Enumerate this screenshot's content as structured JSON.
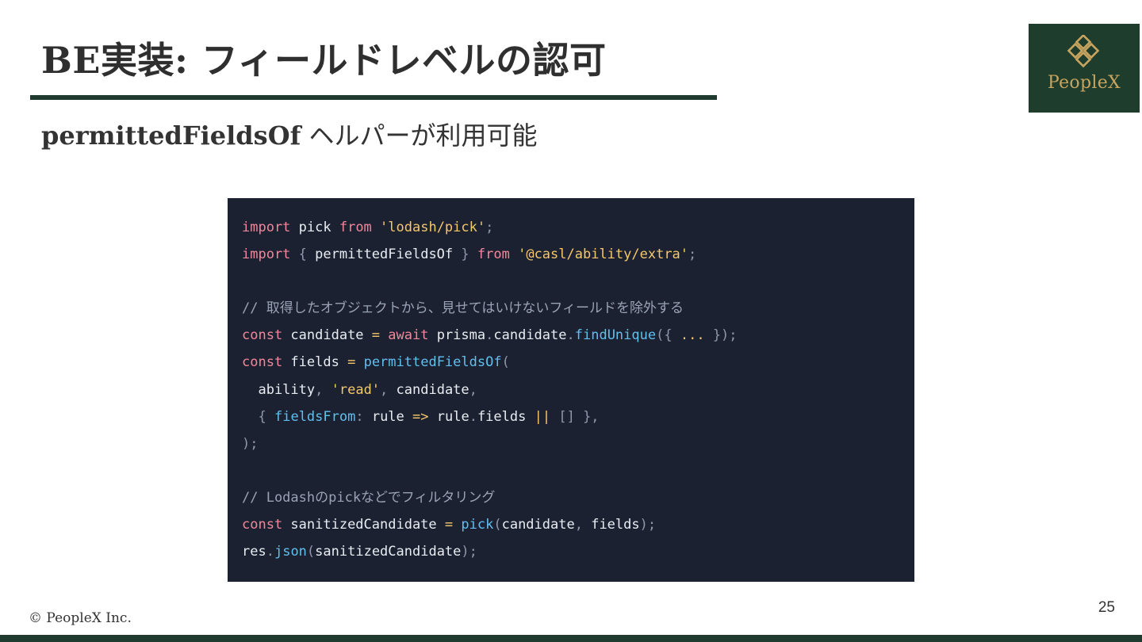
{
  "slide": {
    "title": "BE実装: フィールドレベルの認可",
    "subtitle_bold": "permittedFieldsOf",
    "subtitle_rest": " ヘルパーが利用可能",
    "logo_text": "PeopleX",
    "footer": "© PeopleX Inc.",
    "page_number": "25"
  },
  "colors": {
    "brand_dark_green": "#1f3b30",
    "logo_gold": "#c7a45f",
    "code_bg": "#1b2130"
  },
  "code_lines": [
    [
      {
        "t": "import",
        "c": "kw"
      },
      {
        "t": " pick ",
        "c": "tx"
      },
      {
        "t": "from",
        "c": "kw"
      },
      {
        "t": " ",
        "c": "tx"
      },
      {
        "t": "'lodash/pick'",
        "c": "str"
      },
      {
        "t": ";",
        "c": "pu"
      }
    ],
    [
      {
        "t": "import",
        "c": "kw"
      },
      {
        "t": " ",
        "c": "tx"
      },
      {
        "t": "{",
        "c": "pu"
      },
      {
        "t": " permittedFieldsOf ",
        "c": "tx"
      },
      {
        "t": "}",
        "c": "pu"
      },
      {
        "t": " ",
        "c": "tx"
      },
      {
        "t": "from",
        "c": "kw"
      },
      {
        "t": " ",
        "c": "tx"
      },
      {
        "t": "'@casl/ability/extra'",
        "c": "str"
      },
      {
        "t": ";",
        "c": "pu"
      }
    ],
    [],
    [
      {
        "t": "// 取得したオブジェクトから、見せてはいけないフィールドを除外する",
        "c": "cm"
      }
    ],
    [
      {
        "t": "const",
        "c": "kw"
      },
      {
        "t": " candidate ",
        "c": "tx"
      },
      {
        "t": "=",
        "c": "op"
      },
      {
        "t": " ",
        "c": "tx"
      },
      {
        "t": "await",
        "c": "kw"
      },
      {
        "t": " prisma",
        "c": "tx"
      },
      {
        "t": ".",
        "c": "pu"
      },
      {
        "t": "candidate",
        "c": "tx"
      },
      {
        "t": ".",
        "c": "pu"
      },
      {
        "t": "findUnique",
        "c": "fn"
      },
      {
        "t": "({",
        "c": "pu"
      },
      {
        "t": " ",
        "c": "tx"
      },
      {
        "t": "...",
        "c": "op"
      },
      {
        "t": " ",
        "c": "tx"
      },
      {
        "t": "});",
        "c": "pu"
      }
    ],
    [
      {
        "t": "const",
        "c": "kw"
      },
      {
        "t": " fields ",
        "c": "tx"
      },
      {
        "t": "=",
        "c": "op"
      },
      {
        "t": " ",
        "c": "tx"
      },
      {
        "t": "permittedFieldsOf",
        "c": "fn"
      },
      {
        "t": "(",
        "c": "pu"
      }
    ],
    [
      {
        "t": "  ability",
        "c": "tx"
      },
      {
        "t": ",",
        "c": "pu"
      },
      {
        "t": " ",
        "c": "tx"
      },
      {
        "t": "'read'",
        "c": "str"
      },
      {
        "t": ",",
        "c": "pu"
      },
      {
        "t": " candidate",
        "c": "tx"
      },
      {
        "t": ",",
        "c": "pu"
      }
    ],
    [
      {
        "t": "  ",
        "c": "tx"
      },
      {
        "t": "{",
        "c": "pu"
      },
      {
        "t": " ",
        "c": "tx"
      },
      {
        "t": "fieldsFrom",
        "c": "fn"
      },
      {
        "t": ":",
        "c": "pu"
      },
      {
        "t": " rule ",
        "c": "tx"
      },
      {
        "t": "=>",
        "c": "op"
      },
      {
        "t": " rule",
        "c": "tx"
      },
      {
        "t": ".",
        "c": "pu"
      },
      {
        "t": "fields ",
        "c": "tx"
      },
      {
        "t": "||",
        "c": "op"
      },
      {
        "t": " ",
        "c": "tx"
      },
      {
        "t": "[]",
        "c": "pu"
      },
      {
        "t": " ",
        "c": "tx"
      },
      {
        "t": "},",
        "c": "pu"
      }
    ],
    [
      {
        "t": ");",
        "c": "pu"
      }
    ],
    [],
    [
      {
        "t": "// Lodashのpickなどでフィルタリング",
        "c": "cm"
      }
    ],
    [
      {
        "t": "const",
        "c": "kw"
      },
      {
        "t": " sanitizedCandidate ",
        "c": "tx"
      },
      {
        "t": "=",
        "c": "op"
      },
      {
        "t": " ",
        "c": "tx"
      },
      {
        "t": "pick",
        "c": "fn"
      },
      {
        "t": "(",
        "c": "pu"
      },
      {
        "t": "candidate",
        "c": "tx"
      },
      {
        "t": ",",
        "c": "pu"
      },
      {
        "t": " fields",
        "c": "tx"
      },
      {
        "t": ");",
        "c": "pu"
      }
    ],
    [
      {
        "t": "res",
        "c": "tx"
      },
      {
        "t": ".",
        "c": "pu"
      },
      {
        "t": "json",
        "c": "fn"
      },
      {
        "t": "(",
        "c": "pu"
      },
      {
        "t": "sanitizedCandidate",
        "c": "tx"
      },
      {
        "t": ");",
        "c": "pu"
      }
    ]
  ]
}
